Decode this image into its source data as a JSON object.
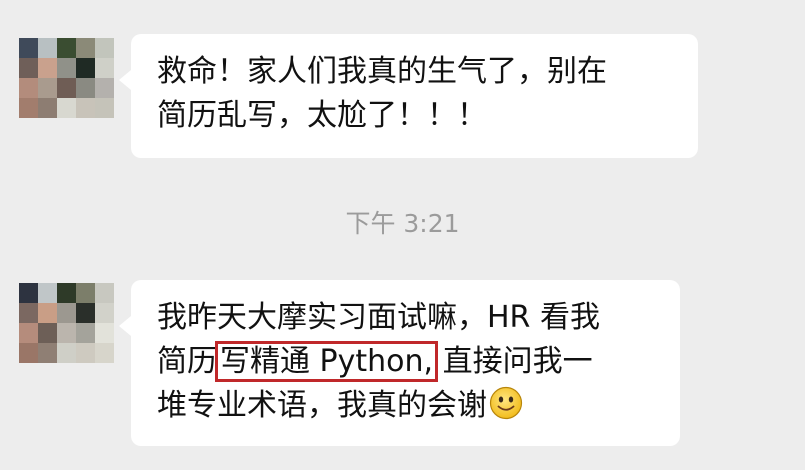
{
  "chat": {
    "messages": [
      {
        "lines": [
          "救命！家人们我真的生气了，别在",
          "简历乱写，太尬了！！！"
        ]
      },
      {
        "line1": "我昨天大摩实习面试嘛，HR 看我",
        "line2_prefix": "简历",
        "line2_highlight": "写精通 Python,",
        "line2_suffix": "直接问我一",
        "line3": "堆专业术语，我真的会谢",
        "emoji": "smile-emoji"
      }
    ],
    "timestamp": "下午 3:21"
  },
  "colors": {
    "background": "#ededed",
    "bubble": "#ffffff",
    "highlight_border": "#c0282a",
    "timestamp_text": "#9b9b9b"
  },
  "avatars": [
    {
      "pixels": [
        "#3f4a5a",
        "#b8c0c2",
        "#3a4d31",
        "#8b8a78",
        "#c2c5bc",
        "#6f5f59",
        "#c9a18d",
        "#909189",
        "#1f2a24",
        "#cfd0c8",
        "#b38c7c",
        "#a99b8e",
        "#6f5d55",
        "#8a8a82",
        "#b4b1ad",
        "#a27d6d",
        "#8d7d72",
        "#d8d8d0",
        "#c8c3b9",
        "#c5c3b9"
      ]
    },
    {
      "pixels": [
        "#2d3340",
        "#c0c6c8",
        "#2e3a28",
        "#7c7e6a",
        "#c8c8c0",
        "#7b6861",
        "#c99e86",
        "#9c9890",
        "#2a2f2a",
        "#d2d2ca",
        "#b58c7c",
        "#6d5f57",
        "#bbb5ad",
        "#a4a39b",
        "#e2e2da",
        "#9a7667",
        "#8f7f74",
        "#cfcfc7",
        "#cecac0",
        "#d7d5cb"
      ]
    }
  ]
}
